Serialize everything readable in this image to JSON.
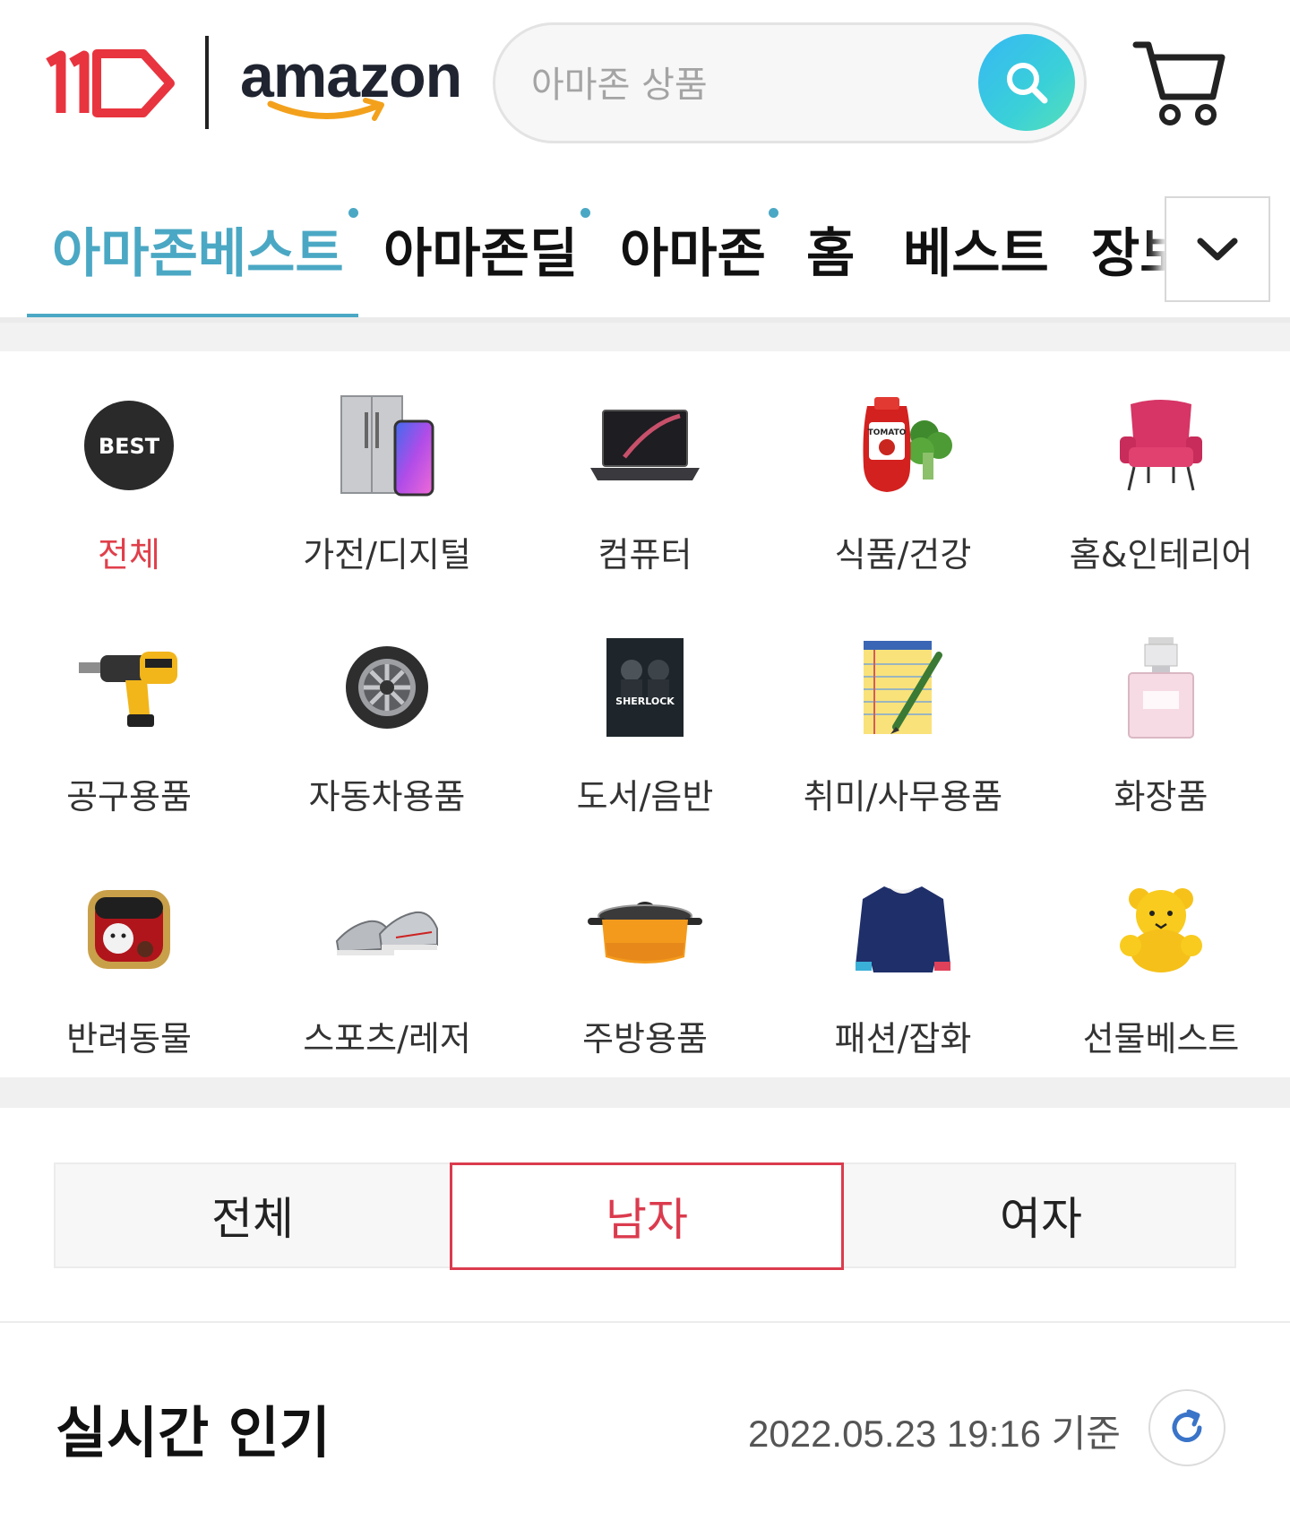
{
  "header": {
    "logo_11st": "11",
    "logo_amazon": "amazon",
    "search_placeholder": "아마존 상품",
    "search_icon": "search-icon",
    "cart_icon": "cart-icon"
  },
  "nav": {
    "tabs": [
      {
        "label": "아마존베스트",
        "active": true,
        "dot": true
      },
      {
        "label": "아마존딜",
        "active": false,
        "dot": true
      },
      {
        "label": "아마존",
        "active": false,
        "dot": true
      },
      {
        "label": "홈",
        "active": false,
        "dot": false
      },
      {
        "label": "베스트",
        "active": false,
        "dot": false
      },
      {
        "label": "장보기",
        "active": false,
        "dot": false
      }
    ],
    "more_icon": "chevron-down-icon",
    "accent": "#4ba8c4"
  },
  "categories": [
    {
      "label": "전체",
      "icon": "best-badge-icon",
      "badge": "BEST",
      "selected": true
    },
    {
      "label": "가전/디지털",
      "icon": "fridge-phone-icon"
    },
    {
      "label": "컴퓨터",
      "icon": "laptop-icon"
    },
    {
      "label": "식품/건강",
      "icon": "ketchup-broccoli-icon",
      "badge": "TOMATO"
    },
    {
      "label": "홈&인테리어",
      "icon": "armchair-icon"
    },
    {
      "label": "공구용품",
      "icon": "impact-wrench-icon"
    },
    {
      "label": "자동차용품",
      "icon": "tire-icon"
    },
    {
      "label": "도서/음반",
      "icon": "dvd-cover-icon",
      "badge": "SHERLOCK"
    },
    {
      "label": "취미/사무용품",
      "icon": "notepad-pencil-icon"
    },
    {
      "label": "화장품",
      "icon": "perfume-icon"
    },
    {
      "label": "반려동물",
      "icon": "pet-food-icon"
    },
    {
      "label": "스포츠/레저",
      "icon": "sneakers-icon"
    },
    {
      "label": "주방용품",
      "icon": "pot-icon"
    },
    {
      "label": "패션/잡화",
      "icon": "sweatshirt-icon"
    },
    {
      "label": "선물베스트",
      "icon": "teddy-bear-icon"
    }
  ],
  "segment": {
    "options": [
      "전체",
      "남자",
      "여자"
    ],
    "selected": "남자",
    "accent": "#db3b4e"
  },
  "realtime": {
    "title": "실시간 인기",
    "timestamp": "2022.05.23 19:16 기준",
    "refresh_icon": "refresh-icon"
  }
}
